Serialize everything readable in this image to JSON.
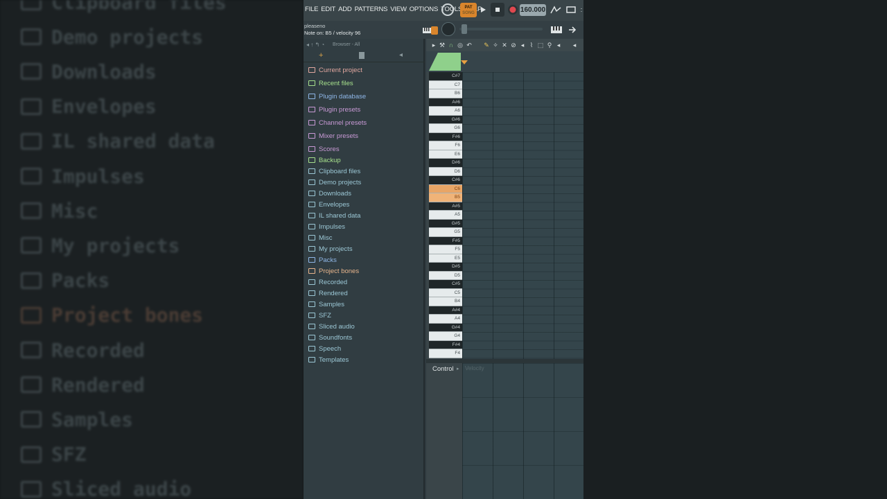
{
  "background": {
    "items": [
      {
        "label": "Clipboard files",
        "tone": "cool"
      },
      {
        "label": "Demo projects",
        "tone": "cool"
      },
      {
        "label": "Downloads",
        "tone": "cool"
      },
      {
        "label": "Envelopes",
        "tone": "cool"
      },
      {
        "label": "IL shared data",
        "tone": "cool"
      },
      {
        "label": "Impulses",
        "tone": "cool"
      },
      {
        "label": "Misc",
        "tone": "cool"
      },
      {
        "label": "My projects",
        "tone": "cool"
      },
      {
        "label": "Packs",
        "tone": "cool"
      },
      {
        "label": "Project bones",
        "tone": "warm"
      },
      {
        "label": "Recorded",
        "tone": "cool"
      },
      {
        "label": "Rendered",
        "tone": "cool"
      },
      {
        "label": "Samples",
        "tone": "cool"
      },
      {
        "label": "SFZ",
        "tone": "cool"
      },
      {
        "label": "Sliced audio",
        "tone": "cool"
      }
    ]
  },
  "menubar": {
    "items": [
      "FILE",
      "EDIT",
      "ADD",
      "PATTERNS",
      "VIEW",
      "OPTIONS",
      "TOOLS",
      "HELP"
    ],
    "pat_label": "PAT",
    "song_label": "SONG",
    "tempo": "160.000",
    "icons": [
      "metronome-icon",
      "play-icon",
      "stop-icon",
      "record-icon"
    ]
  },
  "hint": {
    "title": "pleaseno",
    "text": "Note on: B5 / velocity 96"
  },
  "browser": {
    "title": "Browser - All",
    "items": [
      {
        "label": "Current project",
        "color": "#e3a8a0",
        "icon": "project-icon"
      },
      {
        "label": "Recent files",
        "color": "#a6e08c",
        "icon": "recent-folder-icon"
      },
      {
        "label": "Plugin database",
        "color": "#8fb7e8",
        "icon": "plug-icon"
      },
      {
        "label": "Plugin presets",
        "color": "#c99ad6",
        "icon": "plug-preset-icon"
      },
      {
        "label": "Channel presets",
        "color": "#c99ad6",
        "icon": "channel-icon"
      },
      {
        "label": "Mixer presets",
        "color": "#c99ad6",
        "icon": "mixer-icon"
      },
      {
        "label": "Scores",
        "color": "#c99ad6",
        "icon": "note-icon"
      },
      {
        "label": "Backup",
        "color": "#a6e08c",
        "icon": "backup-folder-icon"
      },
      {
        "label": "Clipboard files",
        "color": "#9cc8d6",
        "icon": "folder-icon"
      },
      {
        "label": "Demo projects",
        "color": "#9cc8d6",
        "icon": "folder-icon"
      },
      {
        "label": "Downloads",
        "color": "#9cc8d6",
        "icon": "folder-icon"
      },
      {
        "label": "Envelopes",
        "color": "#9cc8d6",
        "icon": "folder-icon"
      },
      {
        "label": "IL shared data",
        "color": "#9cc8d6",
        "icon": "folder-icon"
      },
      {
        "label": "Impulses",
        "color": "#9cc8d6",
        "icon": "folder-icon"
      },
      {
        "label": "Misc",
        "color": "#9cc8d6",
        "icon": "folder-icon"
      },
      {
        "label": "My projects",
        "color": "#9cc8d6",
        "icon": "folder-icon"
      },
      {
        "label": "Packs",
        "color": "#8fb7e8",
        "icon": "packs-icon"
      },
      {
        "label": "Project bones",
        "color": "#e8b58c",
        "icon": "folder-icon"
      },
      {
        "label": "Recorded",
        "color": "#9cc8d6",
        "icon": "recorded-icon"
      },
      {
        "label": "Rendered",
        "color": "#9cc8d6",
        "icon": "rendered-icon"
      },
      {
        "label": "Samples",
        "color": "#9cc8d6",
        "icon": "folder-icon"
      },
      {
        "label": "SFZ",
        "color": "#9cc8d6",
        "icon": "folder-icon"
      },
      {
        "label": "Sliced audio",
        "color": "#9cc8d6",
        "icon": "sliced-icon"
      },
      {
        "label": "Soundfonts",
        "color": "#9cc8d6",
        "icon": "folder-icon"
      },
      {
        "label": "Speech",
        "color": "#9cc8d6",
        "icon": "folder-icon"
      },
      {
        "label": "Templates",
        "color": "#9cc8d6",
        "icon": "folder-icon"
      }
    ]
  },
  "piano_roll": {
    "keys": [
      {
        "label": "C#7",
        "type": "black"
      },
      {
        "label": "C7",
        "type": "white"
      },
      {
        "label": "B6",
        "type": "white"
      },
      {
        "label": "A#6",
        "type": "black"
      },
      {
        "label": "A6",
        "type": "white"
      },
      {
        "label": "G#6",
        "type": "black"
      },
      {
        "label": "G6",
        "type": "white"
      },
      {
        "label": "F#6",
        "type": "black"
      },
      {
        "label": "F6",
        "type": "white"
      },
      {
        "label": "E6",
        "type": "white"
      },
      {
        "label": "D#6",
        "type": "black"
      },
      {
        "label": "D6",
        "type": "white"
      },
      {
        "label": "C#6",
        "type": "black"
      },
      {
        "label": "C6",
        "type": "hl"
      },
      {
        "label": "B5",
        "type": "hl2"
      },
      {
        "label": "A#5",
        "type": "black"
      },
      {
        "label": "A5",
        "type": "white"
      },
      {
        "label": "G#5",
        "type": "black"
      },
      {
        "label": "G5",
        "type": "white"
      },
      {
        "label": "F#5",
        "type": "black"
      },
      {
        "label": "F5",
        "type": "white"
      },
      {
        "label": "E5",
        "type": "white"
      },
      {
        "label": "D#5",
        "type": "black"
      },
      {
        "label": "D5",
        "type": "white"
      },
      {
        "label": "C#5",
        "type": "black"
      },
      {
        "label": "C5",
        "type": "white"
      },
      {
        "label": "B4",
        "type": "white"
      },
      {
        "label": "A#4",
        "type": "black"
      },
      {
        "label": "A4",
        "type": "white"
      },
      {
        "label": "G#4",
        "type": "black"
      },
      {
        "label": "G4",
        "type": "white"
      },
      {
        "label": "F#4",
        "type": "black"
      },
      {
        "label": "F4",
        "type": "white"
      }
    ],
    "control_label": "Control",
    "velocity_label": "Velocity"
  }
}
